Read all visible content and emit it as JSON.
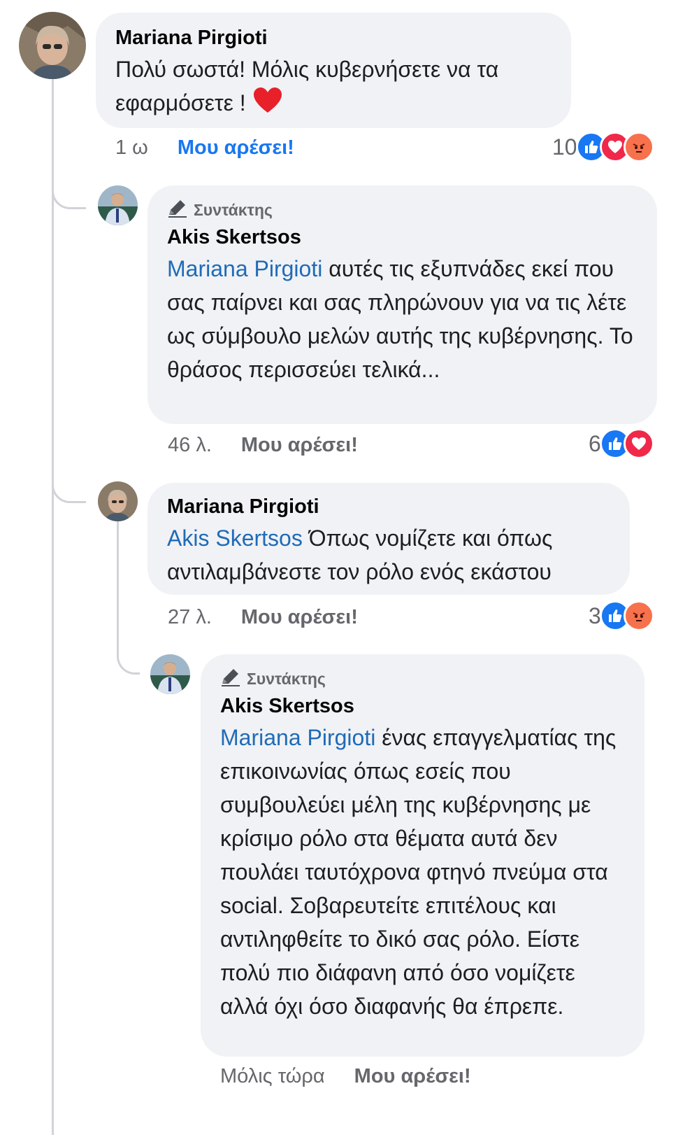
{
  "colors": {
    "like_blue": "#1877f2",
    "mention_blue": "#1f6bb8",
    "love_red": "#f02849",
    "angry_orange": "#f7714c",
    "bubble_gray": "#f0f2f5"
  },
  "comments": [
    {
      "author": "Mariana Pirgioti",
      "text": "Πολύ σωστά! Μόλις κυβερνήσετε να τα εφαρμόσετε !",
      "emoji": "heart-emoji",
      "time": "1 ω",
      "like_label": "Μου αρέσει!",
      "like_active": true,
      "reaction_count": "10",
      "reactions": [
        "like-icon",
        "love-icon",
        "angry-icon"
      ]
    },
    {
      "badge": "Συντάκτης",
      "author": "Akis Skertsos",
      "mention": "Mariana Pirgioti",
      "text": " αυτές τις εξυπνάδες εκεί που σας παίρνει και σας πληρώνουν για να τις λέτε ως σύμβουλο μελών αυτής της κυβέρνησης. Το θράσος περισσεύει τελικά...",
      "time": "46 λ.",
      "like_label": "Μου αρέσει!",
      "reaction_count": "6",
      "reactions": [
        "like-icon",
        "love-icon"
      ]
    },
    {
      "author": "Mariana Pirgioti",
      "mention": "Akis Skertsos",
      "text": " Όπως νομίζετε και όπως αντιλαμβάνεστε τον ρόλο ενός εκάστου",
      "time": "27 λ.",
      "like_label": "Μου αρέσει!",
      "reaction_count": "3",
      "reactions": [
        "like-icon",
        "angry-icon"
      ]
    },
    {
      "badge": "Συντάκτης",
      "author": "Akis Skertsos",
      "mention": "Mariana Pirgioti",
      "text": " ένας επαγγελματίας της επικοινωνίας όπως εσείς που συμβουλεύει μέλη της κυβέρνησης με κρίσιμο ρόλο στα θέματα αυτά δεν πουλάει ταυτόχρονα φτηνό πνεύμα στα social. Σοβαρευτείτε επιτέλους και αντιληφθείτε το δικό σας ρόλο. Είστε πολύ πιο διάφανη από όσο νομίζετε αλλά όχι όσο διαφανής θα έπρεπε.",
      "time": "Μόλις τώρα",
      "like_label": "Μου αρέσει!"
    }
  ]
}
